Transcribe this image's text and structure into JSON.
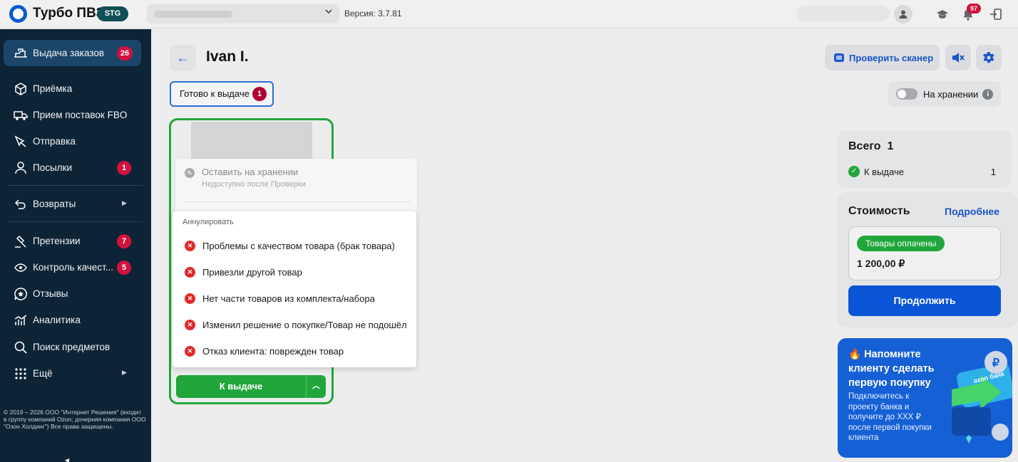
{
  "colors": {
    "brand": "#0b5bd3",
    "sidebar": "#0d2436",
    "success": "#21a63b",
    "danger": "#e02a2a",
    "primary": "#0a55d6",
    "badge": "#d1113d"
  },
  "topbar": {
    "app_title": "Турбо ПВЗ",
    "env_badge": "STG",
    "version": "Версия: 3.7.81",
    "notifications_count": "97"
  },
  "sidebar": {
    "items": [
      {
        "label": "Выдача заказов",
        "badge": "26",
        "icon": "truck-user-icon"
      },
      {
        "label": "Приёмка",
        "icon": "box-icon"
      },
      {
        "label": "Прием поставок FBO",
        "icon": "delivery-truck-icon"
      },
      {
        "label": "Отправка",
        "icon": "send-box-icon"
      },
      {
        "label": "Посылки",
        "badge": "1",
        "icon": "person-icon"
      },
      {
        "label": "Возвраты",
        "icon": "return-arrow-icon"
      },
      {
        "label": "Претензии",
        "badge": "7",
        "icon": "gavel-icon"
      },
      {
        "label": "Контроль качест...",
        "badge": "5",
        "icon": "eye-icon"
      },
      {
        "label": "Отзывы",
        "icon": "star-bubble-icon"
      },
      {
        "label": "Аналитика",
        "icon": "chart-icon"
      },
      {
        "label": "Поиск предметов",
        "icon": "search-icon"
      },
      {
        "label": "Ещё",
        "icon": "grid-dots-icon"
      }
    ],
    "copyright": "© 2019 – 2026 ООО \"Интернет Решения\" (входит в группу компаний Ozon; дочерняя компания ООО \"Озон Холдинг\") Все права защищены."
  },
  "main": {
    "title": "Ivan I.",
    "status_tab": {
      "label": "Готово к выдаче",
      "count": "1"
    },
    "scanner_button": "Проверить сканер",
    "storage_toggle": "На хранении",
    "storage_on": false
  },
  "dropdown": {
    "disabled_item": {
      "title": "Оставить на хранении",
      "subtitle": "Недоступно после Проверки"
    },
    "section_header": "Аннулировать",
    "items": [
      "Проблемы с качеством товара (брак товара)",
      "Привезли другой товар",
      "Нет части товаров из комплекта/набора",
      "Изменил решение о покупке/Товар не подошёл",
      "Отказ клиента: поврежден товар"
    ]
  },
  "issue_button": "К выдаче",
  "summary": {
    "total_label": "Всего",
    "total_count": "1",
    "row_label": "К выдаче",
    "row_value": "1"
  },
  "cost": {
    "title": "Стоимость",
    "more_link": "Подробнее",
    "paid_badge": "Товары оплачены",
    "amount": "1 200,00 ₽",
    "continue_button": "Продолжить"
  },
  "promo": {
    "headline": "🔥 Напомните клиенту сделать первую покупку",
    "text": "Подключитесь к проекту банка и получите до XXX ₽ после первой покупки клиента",
    "card_brand": "ozon банк"
  }
}
